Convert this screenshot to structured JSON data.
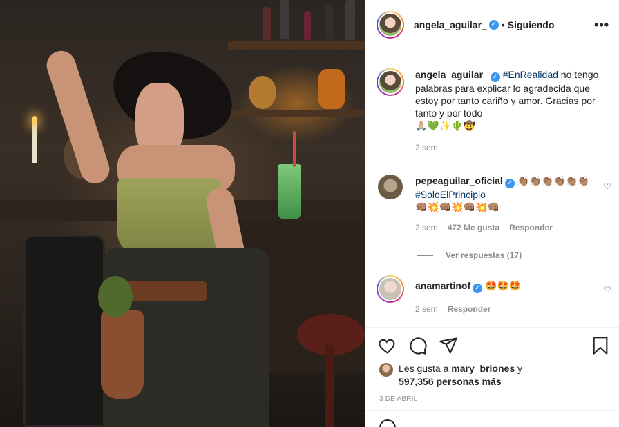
{
  "post": {
    "author": "angela_aguilar_",
    "follow_state": "Siguiendo",
    "more_label": "•••",
    "caption": {
      "username": "angela_aguilar_",
      "hashtag": "#EnRealidad",
      "text": " no tengo palabras para explicar lo agradecida que estoy por tanto cariño y amor. Gracias por tanto y por todo",
      "emojis": "🙏🏼💚✨🌵🤠",
      "time": "2 sem"
    },
    "comments": [
      {
        "username": "pepeaguilar_oficial",
        "emojis_1": "👏🏽👏🏽👏🏽👏🏽👏🏽👏🏽",
        "hashtag": "#SoloElPrincipio",
        "emojis_2": "👊🏽💥👊🏽💥👊🏽💥👊🏽",
        "time": "2 sem",
        "likes": "472 Me gusta",
        "reply_label": "Responder",
        "view_replies": "Ver respuestas (17)"
      },
      {
        "username": "anamartinof",
        "text": "🤩🤩🤩",
        "time": "2 sem",
        "reply_label": "Responder"
      }
    ],
    "likes": {
      "prefix": "Les gusta a ",
      "user": "mary_briones",
      "middle": " y",
      "count": "597,356 personas más"
    },
    "date": "3 DE ABRIL"
  },
  "colors": {
    "link": "#00376b",
    "muted": "#8e8e8e",
    "verified": "#3897f0"
  },
  "icons": {
    "verified": "verified-badge-icon",
    "like": "heart-icon",
    "comment": "comment-icon",
    "share": "paper-plane-icon",
    "save": "bookmark-icon"
  }
}
